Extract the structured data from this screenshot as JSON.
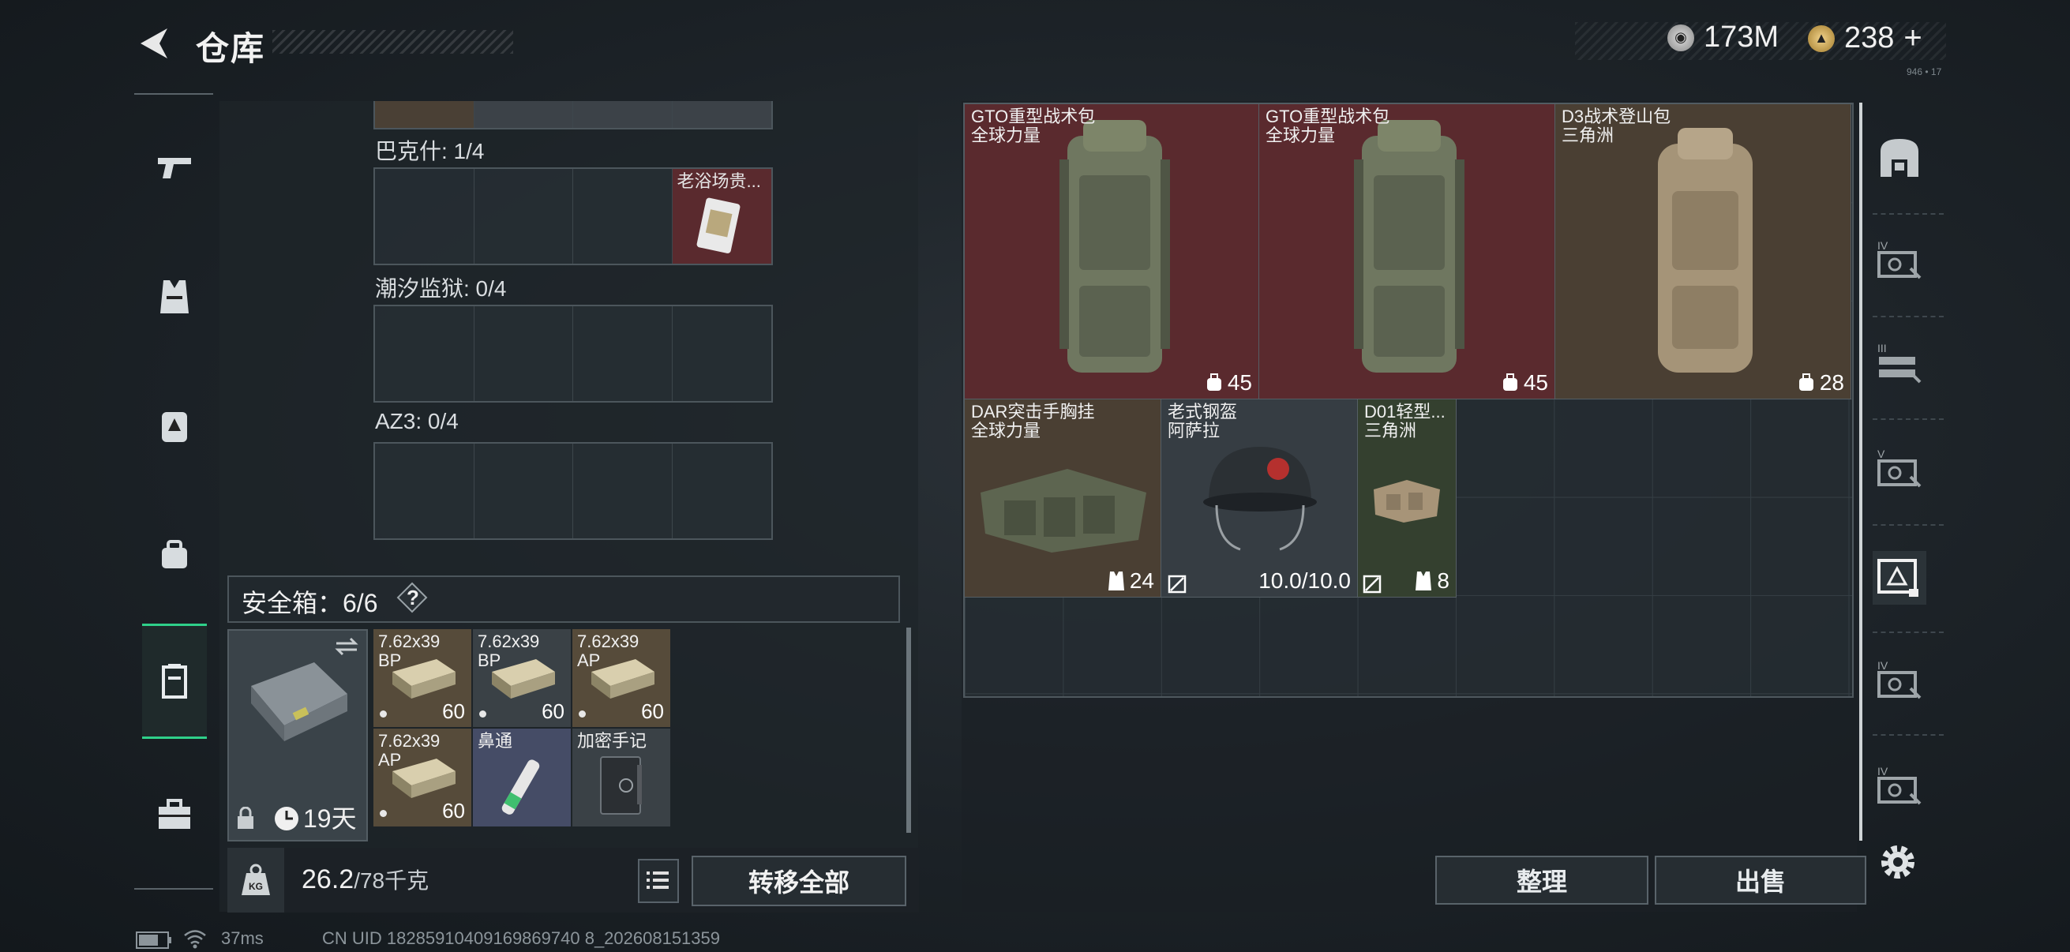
{
  "header": {
    "title": "仓库",
    "currency_1": "173M",
    "currency_2": "238",
    "plus": "+",
    "tiny_text": "946 • 17"
  },
  "left_panel": {
    "sections": [
      {
        "label": "巴克什: 1/4",
        "items": [
          "",
          "",
          "",
          "老浴场贵..."
        ]
      },
      {
        "label": "潮汐监狱: 0/4",
        "items": [
          "",
          "",
          "",
          ""
        ]
      },
      {
        "label": "AZ3: 0/4",
        "items": [
          "",
          "",
          "",
          ""
        ]
      }
    ],
    "safe_box": {
      "label": "安全箱：6/6",
      "help": "?",
      "days": "19天",
      "items": [
        {
          "name": "7.62x39\nBP",
          "count": "60"
        },
        {
          "name": "7.62x39\nBP",
          "count": "60"
        },
        {
          "name": "7.62x39\nAP",
          "count": "60"
        },
        {
          "name": "7.62x39\nAP",
          "count": "60"
        },
        {
          "name": "鼻通",
          "count": ""
        },
        {
          "name": "加密手记",
          "count": ""
        }
      ]
    },
    "weight_current": "26.2",
    "weight_max": "/78千克",
    "transfer_all": "转移全部"
  },
  "storage": {
    "items": [
      {
        "name": "GTO重型战术包\n全球力量",
        "cap": "45"
      },
      {
        "name": "GTO重型战术包\n全球力量",
        "cap": "45"
      },
      {
        "name": "D3战术登山包\n三角洲",
        "cap": "28"
      },
      {
        "name": "DAR突击手胸挂\n全球力量",
        "cap": "24"
      },
      {
        "name": "老式钢盔\n阿萨拉",
        "cap": "10.0/10.0"
      },
      {
        "name": "D01轻型...\n三角洲",
        "cap": "8"
      }
    ],
    "sort": "整理",
    "sell": "出售"
  },
  "status_bar": {
    "ping": "37ms",
    "uid": "CN UID 18285910409169869740 8_202608151359"
  },
  "colors": {
    "accent": "#2fd08a",
    "red_item": "#5a2a2e",
    "brown_item": "#4a3f33"
  }
}
